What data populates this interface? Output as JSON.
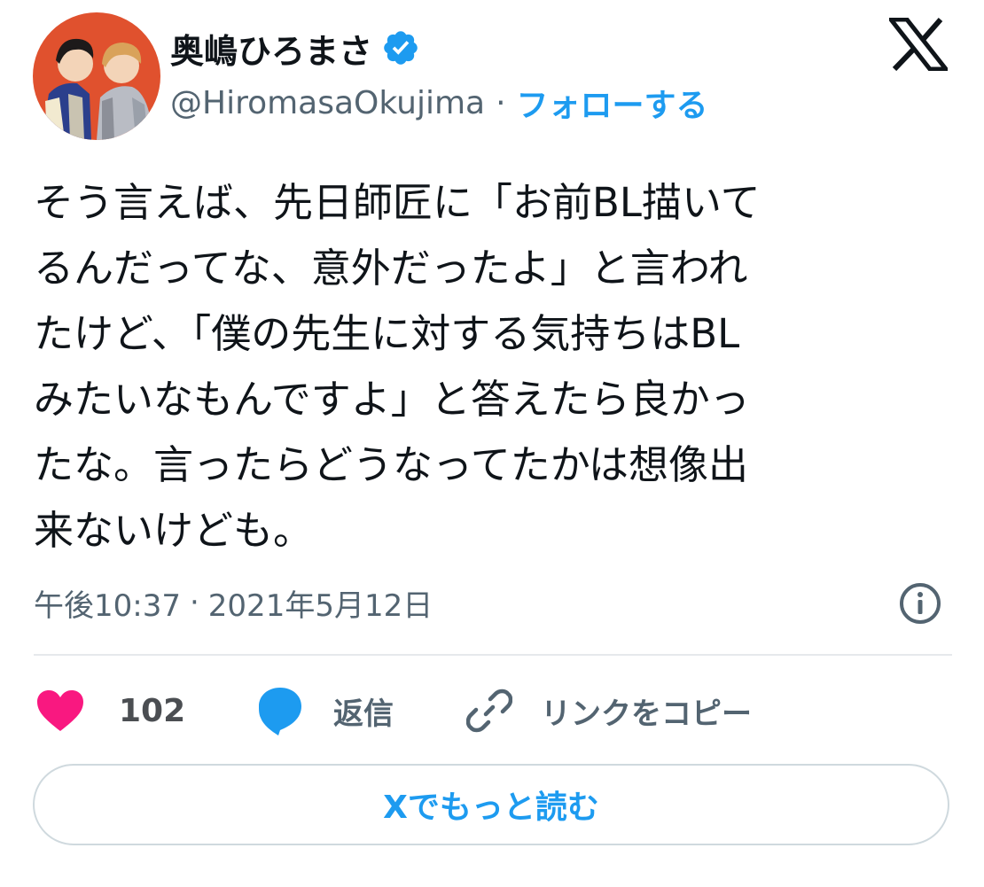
{
  "header": {
    "display_name": "奥嶋ひろまさ",
    "handle": "@HiromasaOkujima",
    "separator": "·",
    "follow_label": "フォローする",
    "verified_icon": "verified-badge-icon",
    "logo_icon": "x-logo-icon"
  },
  "tweet": {
    "lines": [
      "そう言えば、先日師匠に「お前BL描いて",
      "るんだってな、意外だったよ」と言われ",
      "たけど、「僕の先生に対する気持ちはBL",
      "みたいなもんですよ」と答えたら良かっ",
      "たな。言ったらどうなってたかは想像出",
      "来ないけども。"
    ]
  },
  "meta": {
    "time": "午後10:37",
    "separator": "·",
    "date": "2021年5月12日",
    "info_icon": "info-icon"
  },
  "actions": {
    "like_count": "102",
    "reply_label": "返信",
    "copy_link_label": "リンクをコピー"
  },
  "read_more": {
    "label": "Xでもっと読む"
  },
  "colors": {
    "accent": "#1d9bf0",
    "heart": "#f91880",
    "text": "#0f1419",
    "muted": "#536471",
    "border": "#cfd9de"
  }
}
